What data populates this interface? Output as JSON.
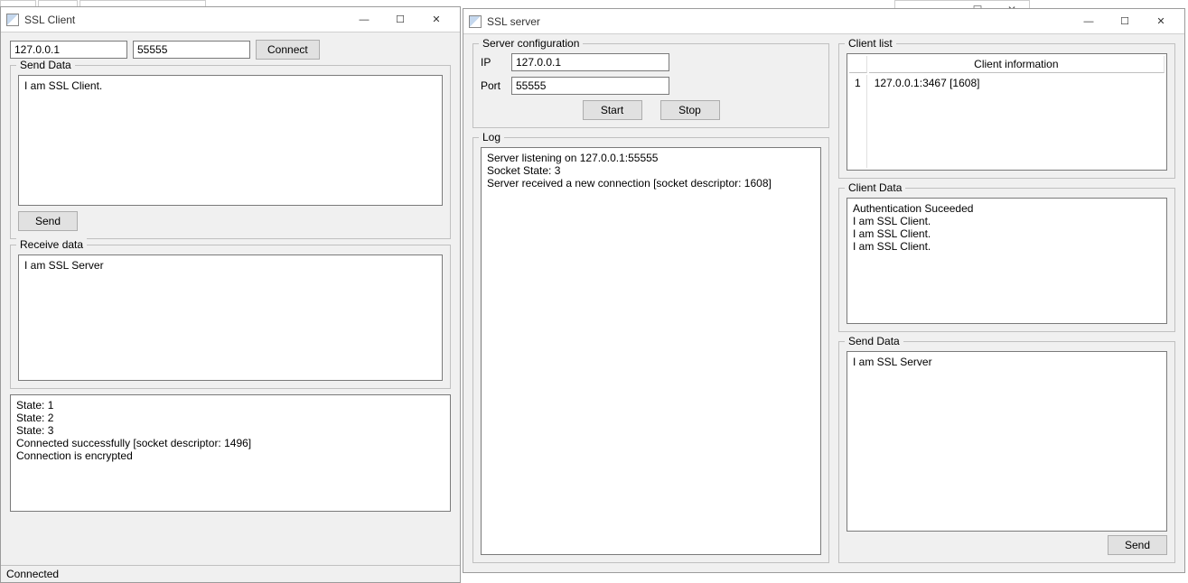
{
  "bg_controls": {
    "min": "—",
    "max": "☐",
    "close": "✕"
  },
  "client": {
    "title": "SSL Client",
    "win_controls": {
      "min": "—",
      "max": "☐",
      "close": "✕"
    },
    "host_value": "127.0.0.1",
    "port_value": "55555",
    "connect_label": "Connect",
    "send_group": "Send Data",
    "send_text": "I am SSL Client.",
    "send_button": "Send",
    "recv_group": "Receive data",
    "recv_text": "I am SSL Server",
    "log_text": "State: 1\nState: 2\nState: 3\nConnected successfully [socket descriptor: 1496]\nConnection is encrypted",
    "status": "Connected"
  },
  "server": {
    "title": "SSL server",
    "win_controls": {
      "min": "—",
      "max": "☐",
      "close": "✕"
    },
    "cfg_group": "Server configuration",
    "ip_label": "IP",
    "ip_value": "127.0.0.1",
    "port_label": "Port",
    "port_value": "55555",
    "start_label": "Start",
    "stop_label": "Stop",
    "log_group": "Log",
    "log_text": "Server listening on 127.0.0.1:55555\nSocket State: 3\nServer received a new connection [socket descriptor: 1608]",
    "client_list_group": "Client list",
    "client_list_header": "Client information",
    "client_list_rows": [
      {
        "idx": "1",
        "info": "127.0.0.1:3467 [1608]"
      }
    ],
    "client_data_group": "Client Data",
    "client_data_text": "Authentication Suceeded\nI am SSL Client.\nI am SSL Client.\nI am SSL Client.",
    "send_group": "Send Data",
    "send_text": "I am SSL Server",
    "send_button": "Send"
  }
}
